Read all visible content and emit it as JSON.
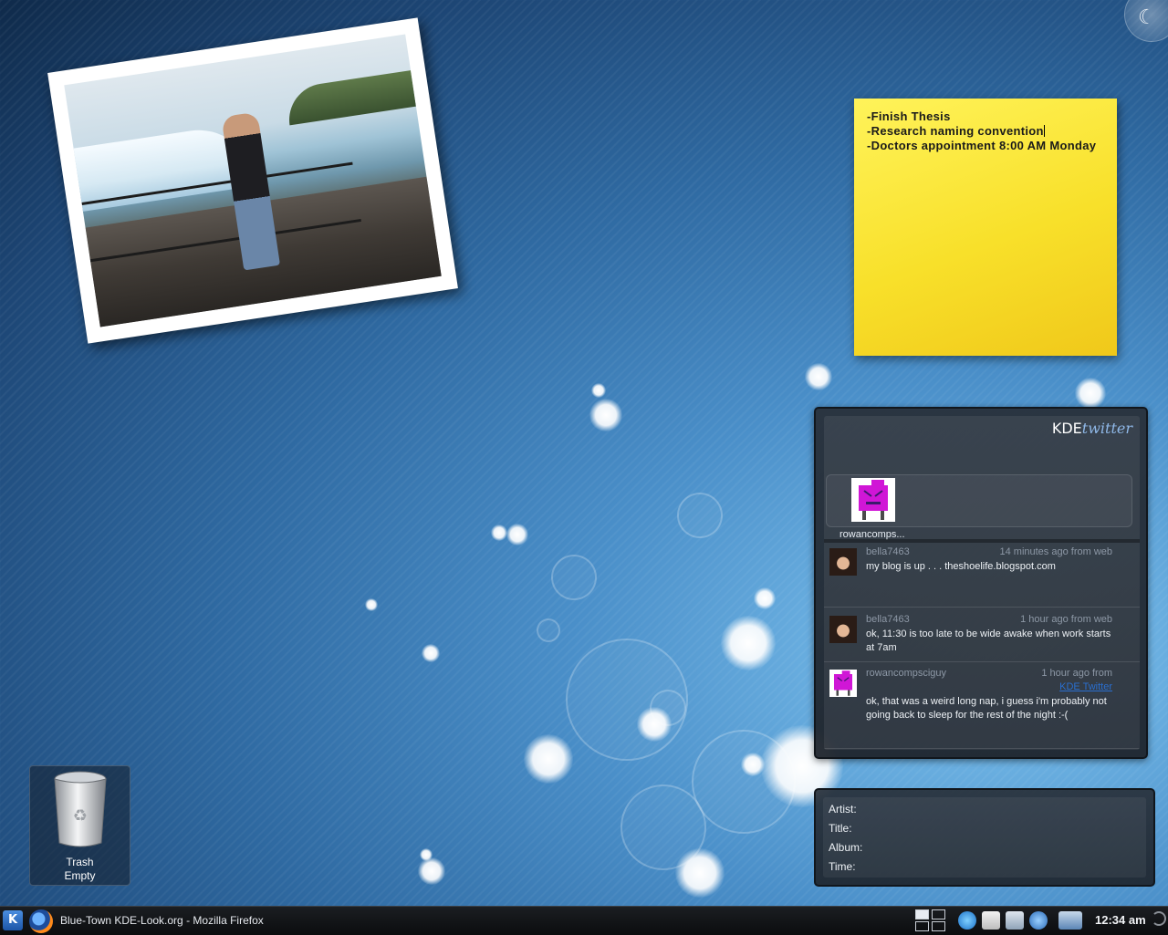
{
  "desktop": {
    "sticky_note": {
      "lines": [
        "-Finish Thesis",
        "-Research naming convention",
        "-Doctors appointment 8:00 AM Monday"
      ]
    },
    "twitter": {
      "logo_kde": "KDE",
      "logo_twitter": "twitter",
      "self_username": "rowancomps...",
      "tweets": [
        {
          "user": "bella7463",
          "meta": "14 minutes ago from web",
          "text": "my blog is up . . . theshoelife.blogspot.com"
        },
        {
          "user": "bella7463",
          "meta": "1 hour ago from web",
          "text": "ok, 11:30 is too late to be wide awake when work starts at 7am"
        },
        {
          "user": "rowancompsciguy",
          "meta": "1 hour ago from",
          "meta_link": "KDE Twitter",
          "text": "ok, that was a weird long nap, i guess i'm probably not going back to sleep for the rest of the night :-("
        }
      ]
    },
    "now_playing": {
      "artist_label": "Artist:",
      "title_label": "Title:",
      "album_label": "Album:",
      "time_label": "Time:"
    },
    "trash": {
      "label": "Trash",
      "status": "Empty"
    }
  },
  "taskbar": {
    "kmenu_glyph": "K",
    "tasks": [
      {
        "label": "Blue-Town KDE-Look.org - Mozilla Firefox"
      }
    ],
    "clock": "12:34 am"
  },
  "colors": {
    "sticky": "#f8e02a",
    "link": "#2a6fd0",
    "panel": "#0b0c0e"
  }
}
